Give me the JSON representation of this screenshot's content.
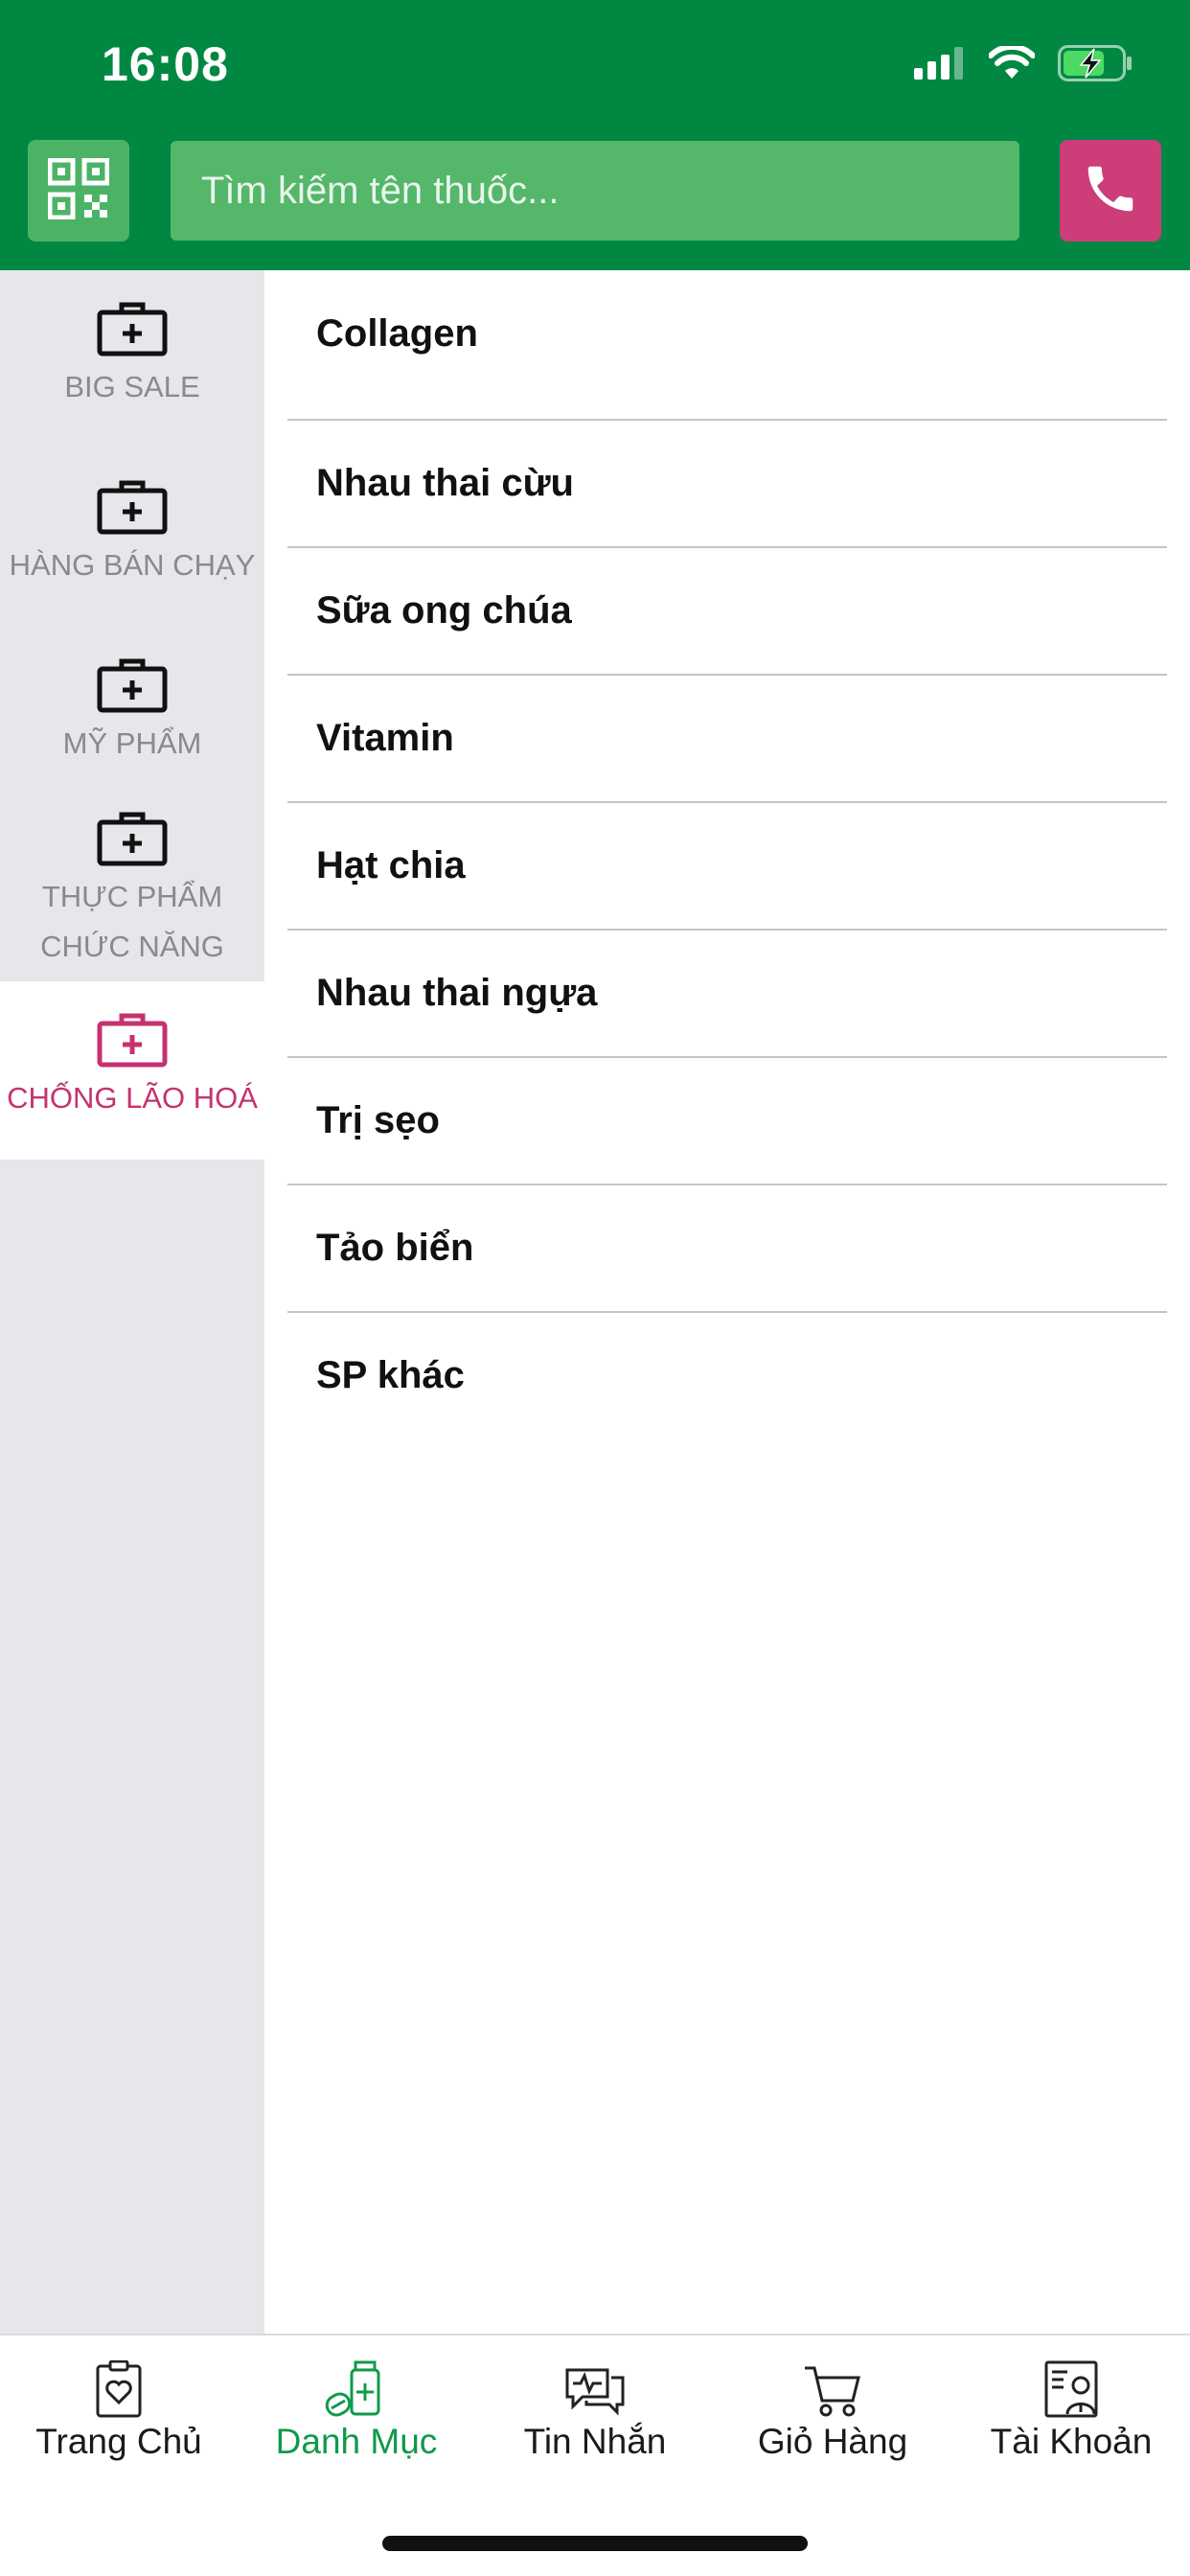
{
  "status_bar": {
    "time": "16:08"
  },
  "header": {
    "search_placeholder": "Tìm kiếm tên thuốc...",
    "qr_icon": "qr-code-icon",
    "phone_icon": "phone-icon",
    "colors": {
      "header_bg": "#008843",
      "search_bg": "#54b76a",
      "phone_bg": "#cc3d7a"
    }
  },
  "sidebar": {
    "items": [
      {
        "label": "BIG SALE",
        "icon": "medical-kit-icon",
        "active": false
      },
      {
        "label": "HÀNG BÁN CHẠY",
        "icon": "medical-kit-icon",
        "active": false
      },
      {
        "label": "MỸ PHẨM",
        "icon": "medical-kit-icon",
        "active": false
      },
      {
        "label": "THỰC PHẨM CHỨC NĂNG",
        "line1": "THỰC PHẨM",
        "line2": "CHỨC NĂNG",
        "icon": "medical-kit-icon",
        "active": false
      },
      {
        "label": "CHỐNG LÃO HOÁ",
        "icon": "medical-kit-icon",
        "active": true
      }
    ],
    "active_color": "#c4336f"
  },
  "categories": [
    "Collagen",
    "Nhau thai cừu",
    "Sữa ong chúa",
    "Vitamin",
    "Hạt chia",
    "Nhau thai ngựa",
    "Trị sẹo",
    "Tảo biển",
    "SP khác"
  ],
  "tabbar": {
    "tabs": [
      {
        "label": "Trang Chủ",
        "icon": "clipboard-heart-icon",
        "active": false
      },
      {
        "label": "Danh Mục",
        "icon": "medicine-bottle-icon",
        "active": true
      },
      {
        "label": "Tin Nhắn",
        "icon": "chat-bubbles-icon",
        "active": false
      },
      {
        "label": "Giỏ Hàng",
        "icon": "shopping-cart-icon",
        "active": false
      },
      {
        "label": "Tài Khoản",
        "icon": "doctor-profile-icon",
        "active": false
      }
    ],
    "active_color": "#0f9a4a"
  }
}
